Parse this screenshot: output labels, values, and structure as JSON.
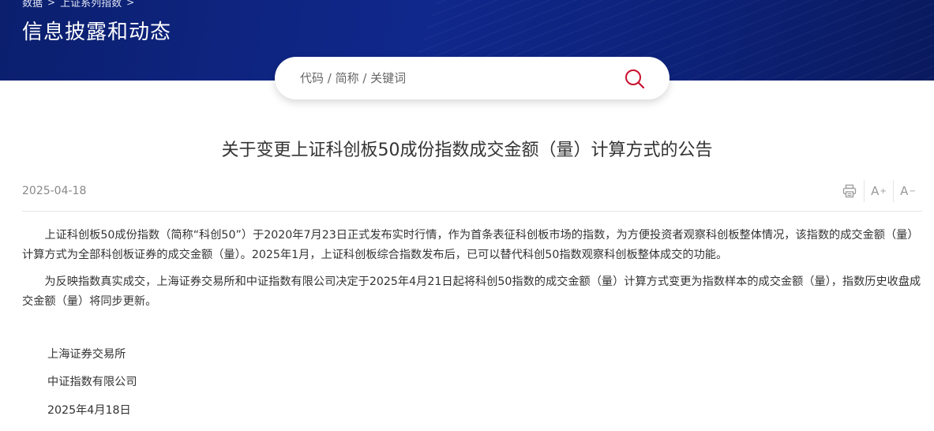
{
  "header": {
    "breadcrumb": [
      "数据",
      "上证系列指数"
    ],
    "breadcrumb_sep": ">",
    "title": "信息披露和动态"
  },
  "search": {
    "placeholder": "代码 / 简称 / 关键词",
    "icon": "search-icon"
  },
  "article": {
    "title": "关于变更上证科创板50成份指数成交金额（量）计算方式的公告",
    "date": "2025-04-18",
    "tools": {
      "print_icon": "print-icon",
      "font_increase": "A",
      "font_increase_sign": "+",
      "font_decrease": "A",
      "font_decrease_sign": "−"
    },
    "paragraphs": [
      "上证科创板50成份指数（简称“科创50”）于2020年7月23日正式发布实时行情，作为首条表征科创板市场的指数，为方便投资者观察科创板整体情况，该指数的成交金额（量）计算方式为全部科创板证券的成交金额（量）。2025年1月，上证科创板综合指数发布后，已可以替代科创50指数观察科创板整体成交的功能。",
      "为反映指数真实成交，上海证券交易所和中证指数有限公司决定于2025年4月21日起将科创50指数的成交金额（量）计算方式变更为指数样本的成交金额（量），指数历史收盘成交金额（量）将同步更新。"
    ],
    "signatures": [
      "上海证券交易所",
      "中证指数有限公司",
      "2025年4月18日"
    ]
  },
  "colors": {
    "banner": "#10288c",
    "search_icon": "#c8102e",
    "text": "#333333",
    "muted": "#888888"
  }
}
